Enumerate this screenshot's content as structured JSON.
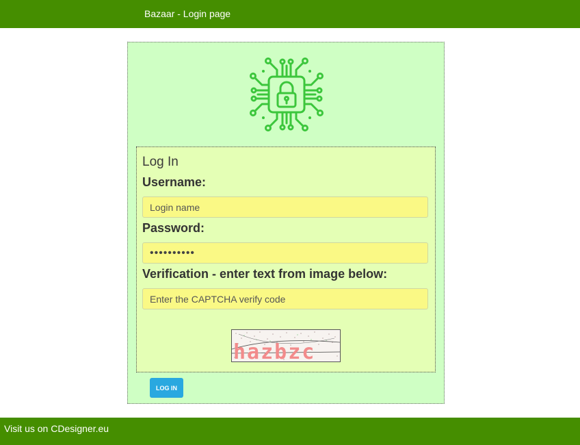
{
  "header": {
    "title": "Bazaar - Login page"
  },
  "logo": {
    "icon": "circuit-padlock-icon",
    "color": "#3cc63c"
  },
  "form": {
    "title": "Log In",
    "username_label": "Username:",
    "username_placeholder": "Login name",
    "password_label": "Password:",
    "password_value": "••••••••••",
    "verification_label": "Verification - enter text from image below:",
    "captcha_placeholder": "Enter the CAPTCHA verify code",
    "captcha_text": "hazbzc",
    "login_label": "LOG IN"
  },
  "footer": {
    "text": "Visit us on CDesigner.eu"
  },
  "colors": {
    "bar_green": "#458e00",
    "panel_green": "#cfffc4",
    "form_yellow_green": "#e4ffb5",
    "input_yellow": "#faf985",
    "button_blue": "#29a8e0",
    "captcha_pink": "#f28b8b"
  }
}
